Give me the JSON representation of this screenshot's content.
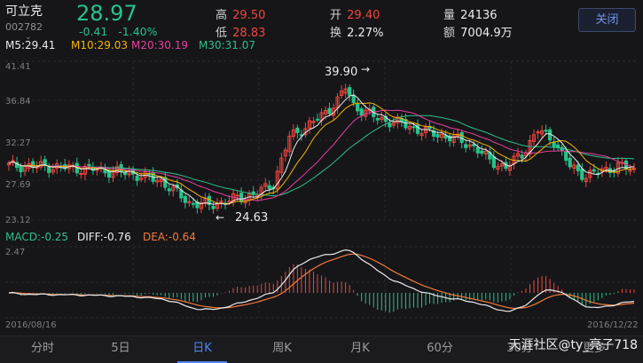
{
  "header": {
    "stock_name": "可立克",
    "stock_code": "002782",
    "price": "28.97",
    "change": "-0.41",
    "change_pct": "-1.40%",
    "high_label": "高",
    "high_value": "29.50",
    "low_label": "低",
    "low_value": "28.83",
    "open_label": "开",
    "open_value": "29.40",
    "turnover_label": "换",
    "turnover_value": "2.27%",
    "volume_label": "量",
    "volume_value": "24136",
    "amount_label": "额",
    "amount_value": "7004.9万",
    "close_label": "关闭"
  },
  "ma_legend": {
    "m5": "M5:29.41",
    "m10": "M10:29.03",
    "m20": "M20:30.19",
    "m30": "M30:31.07"
  },
  "price_axis": {
    "top": "41.41",
    "l2": "36.84",
    "l3": "32.27",
    "l4": "27.69",
    "bottom": "23.12"
  },
  "annotations": {
    "high_mark": "39.90",
    "low_mark": "24.63"
  },
  "macd_legend": {
    "macd": "MACD:-0.25",
    "diff": "DIFF:-0.76",
    "dea": "DEA:-0.64"
  },
  "macd_axis": {
    "top": "2.47"
  },
  "date_range": {
    "start": "2016/08/16",
    "end": "2016/12/22"
  },
  "tabs": [
    "分时",
    "5日",
    "日K",
    "周K",
    "月K",
    "60分",
    "30分",
    "更多"
  ],
  "active_tab": "日K",
  "watermark": "天涯社区@ty_亮子718",
  "colors": {
    "up": "#f0463c",
    "down": "#28c28a",
    "m5": "#ececec",
    "m10": "#f4b400",
    "m20": "#e83e9c",
    "m30": "#2fbf8a",
    "accent": "#4e86f0"
  }
}
